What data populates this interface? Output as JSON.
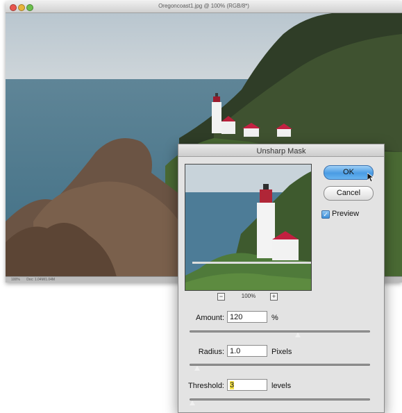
{
  "document": {
    "title": "Oregoncoast1.jpg @ 100% (RGB/8*)",
    "status_zoom": "100%",
    "status_doc": "Doc: 1.04M/1.04M"
  },
  "dialog": {
    "title": "Unsharp Mask",
    "ok_label": "OK",
    "cancel_label": "Cancel",
    "preview_label": "Preview",
    "preview_checked": true,
    "zoom_minus": "−",
    "zoom_level": "100%",
    "zoom_plus": "+",
    "amount": {
      "label": "Amount:",
      "value": "120",
      "unit": "%",
      "slider_fraction": 0.6
    },
    "radius": {
      "label": "Radius:",
      "value": "1.0",
      "unit": "Pixels",
      "slider_fraction": 0.04
    },
    "threshold": {
      "label": "Threshold:",
      "value": "3",
      "unit": "levels",
      "slider_fraction": 0.01
    }
  },
  "colors": {
    "ok_accent": "#4a9be3",
    "input_highlight": "#f4e24a"
  },
  "icons": {
    "checkbox": "checkmark-icon",
    "cursor": "arrow-cursor-icon"
  }
}
